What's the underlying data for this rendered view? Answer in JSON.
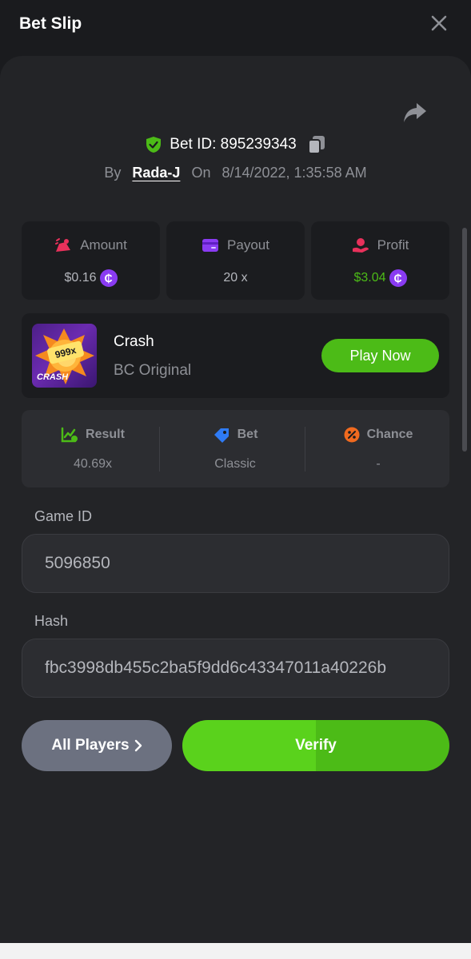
{
  "header": {
    "title": "Bet Slip"
  },
  "bet": {
    "id_label": "Bet ID: 895239343",
    "by_label": "By",
    "user": "Rada-J",
    "on_label": "On",
    "datetime": "8/14/2022, 1:35:58 AM"
  },
  "stats": [
    {
      "label": "Amount",
      "value": "$0.16",
      "coin": "₵",
      "value_color": "#b4b6bc",
      "icon": "amount-icon"
    },
    {
      "label": "Payout",
      "value": "20 x",
      "icon": "payout-icon"
    },
    {
      "label": "Profit",
      "value": "$3.04",
      "coin": "₵",
      "value_color": "#4cbb17",
      "icon": "profit-icon"
    }
  ],
  "game": {
    "name": "Crash",
    "provider": "BC Original",
    "thumb_multiplier": "999x",
    "thumb_label": "CRASH",
    "play_label": "Play Now"
  },
  "result": [
    {
      "label": "Result",
      "value": "40.69x",
      "icon": "result-icon"
    },
    {
      "label": "Bet",
      "value": "Classic",
      "icon": "bet-tag-icon"
    },
    {
      "label": "Chance",
      "value": "-",
      "icon": "percent-icon"
    }
  ],
  "fields": {
    "game_id_label": "Game ID",
    "game_id_value": "5096850",
    "hash_label": "Hash",
    "hash_value": "fbc3998db455c2ba5f9dd6c43347011a40226b"
  },
  "actions": {
    "all_players": "All Players",
    "verify": "Verify"
  },
  "colors": {
    "accent_green": "#4cbb17",
    "coin_purple": "#8a3bf2",
    "background": "#1a1b1e",
    "panel": "#232427"
  }
}
